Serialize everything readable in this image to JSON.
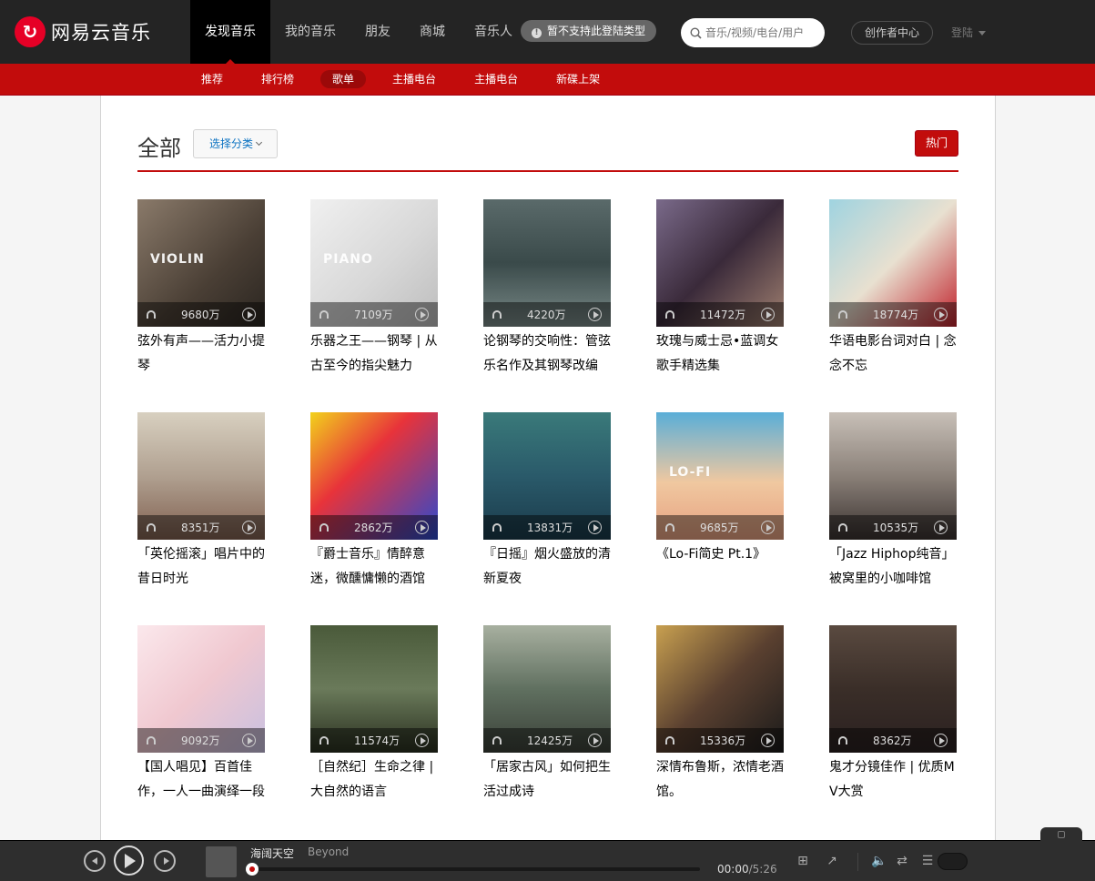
{
  "brand": {
    "name": "网易云音乐",
    "color": "#c20c0c"
  },
  "nav": {
    "items": [
      {
        "label": "发现音乐",
        "active": true
      },
      {
        "label": "我的音乐",
        "active": false
      },
      {
        "label": "朋友",
        "active": false
      },
      {
        "label": "商城",
        "active": false
      },
      {
        "label": "音乐人",
        "active": false
      }
    ],
    "tooltip": "暂不支持此登陆类型"
  },
  "search": {
    "placeholder": "音乐/视频/电台/用户"
  },
  "creator_center": "创作者中心",
  "login": "登陆",
  "subnav": {
    "items": [
      {
        "label": "推荐",
        "active": false
      },
      {
        "label": "排行榜",
        "active": false
      },
      {
        "label": "歌单",
        "active": true
      },
      {
        "label": "主播电台",
        "active": false
      },
      {
        "label": "主播电台",
        "active": false
      },
      {
        "label": "新碟上架",
        "active": false
      }
    ]
  },
  "page": {
    "title": "全部",
    "category_button": "选择分类",
    "hot_button": "热门"
  },
  "playlists": [
    {
      "title": "弦外有声——活力小提琴",
      "plays": "9680万",
      "cover_label": "VIOLIN"
    },
    {
      "title": "乐器之王——钢琴 | 从古至今的指尖魅力",
      "plays": "7109万",
      "cover_label": "PIANO"
    },
    {
      "title": "论钢琴的交响性：管弦乐名作及其钢琴改编",
      "plays": "4220万",
      "cover_label": ""
    },
    {
      "title": "玫瑰与威士忌•蓝调女歌手精选集",
      "plays": "11472万",
      "cover_label": ""
    },
    {
      "title": "华语电影台词对白 | 念念不忘",
      "plays": "18774万",
      "cover_label": ""
    },
    {
      "title": "「英伦摇滚」唱片中的昔日时光",
      "plays": "8351万",
      "cover_label": ""
    },
    {
      "title": "『爵士音乐』情醉意迷，微醺慵懒的酒馆",
      "plays": "2862万",
      "cover_label": ""
    },
    {
      "title": "『日摇』烟火盛放的清新夏夜",
      "plays": "13831万",
      "cover_label": ""
    },
    {
      "title": "《Lo-Fi简史 Pt.1》",
      "plays": "9685万",
      "cover_label": "LO-FI"
    },
    {
      "title": "「Jazz Hiphop纯音」被窝里的小咖啡馆",
      "plays": "10535万",
      "cover_label": ""
    },
    {
      "title": "【国人唱见】百首佳作，一人一曲演绎一段情",
      "plays": "9092万",
      "cover_label": ""
    },
    {
      "title": "［自然纪］生命之律 | 大自然的语言",
      "plays": "11574万",
      "cover_label": ""
    },
    {
      "title": "「居家古风」如何把生活过成诗",
      "plays": "12425万",
      "cover_label": ""
    },
    {
      "title": "深情布鲁斯，浓情老酒馆。",
      "plays": "15336万",
      "cover_label": ""
    },
    {
      "title": "鬼才分镜佳作 | 优质MV大赏",
      "plays": "8362万",
      "cover_label": ""
    }
  ],
  "player": {
    "song": "海阔天空",
    "artist": "Beyond",
    "current_time": "00:00",
    "total_time": "/5:26",
    "progress": 0
  }
}
